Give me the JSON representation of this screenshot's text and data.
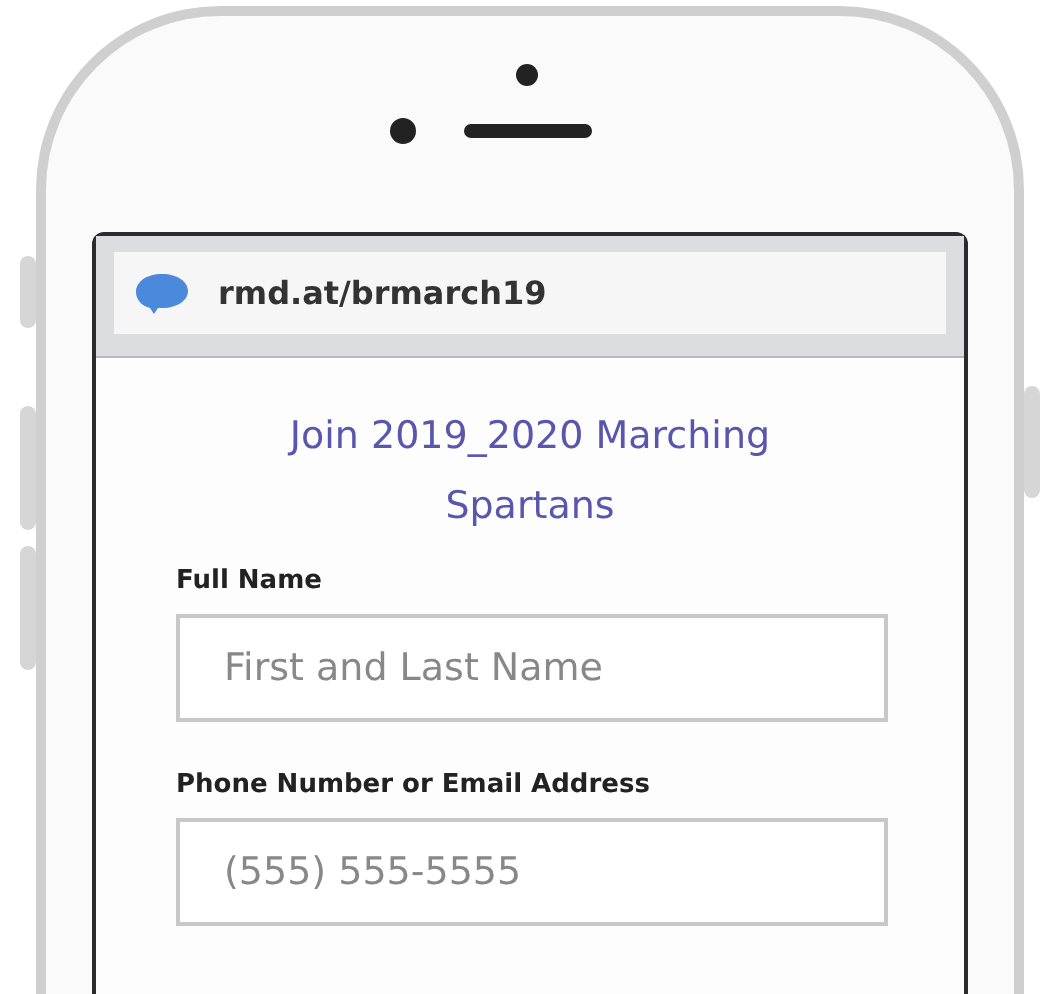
{
  "browser": {
    "url": "rmd.at/brmarch19"
  },
  "form": {
    "title": "Join 2019_2020 Marching Spartans",
    "fields": [
      {
        "label": "Full Name",
        "placeholder": "First and Last Name"
      },
      {
        "label": "Phone Number or Email Address",
        "placeholder": "(555) 555-5555"
      }
    ]
  }
}
